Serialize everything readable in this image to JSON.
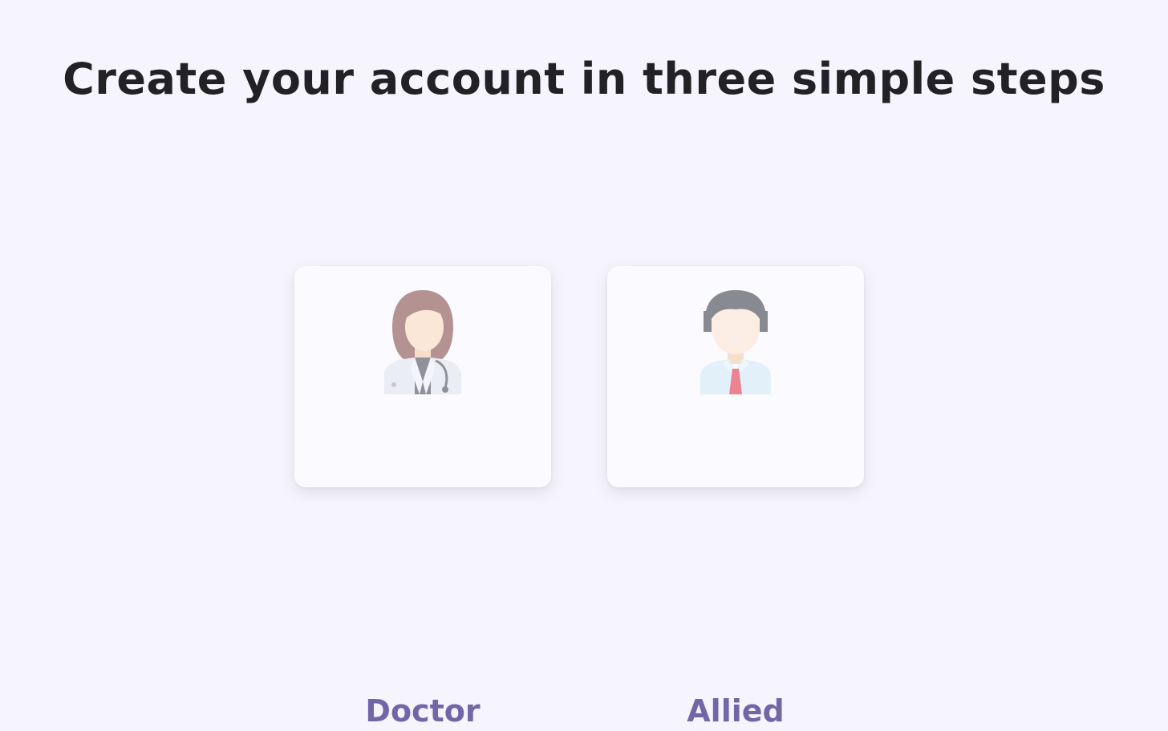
{
  "page": {
    "title": "Create your account in three simple steps"
  },
  "roles": [
    {
      "label": "Doctor",
      "icon": "female-doctor-avatar-icon"
    },
    {
      "label": "Allied",
      "icon": "male-allied-avatar-icon"
    }
  ],
  "colors": {
    "background": "#f6f5fd",
    "card_background": "#fbfaff",
    "title_text": "#222226",
    "accent_label": "#7366a8"
  }
}
